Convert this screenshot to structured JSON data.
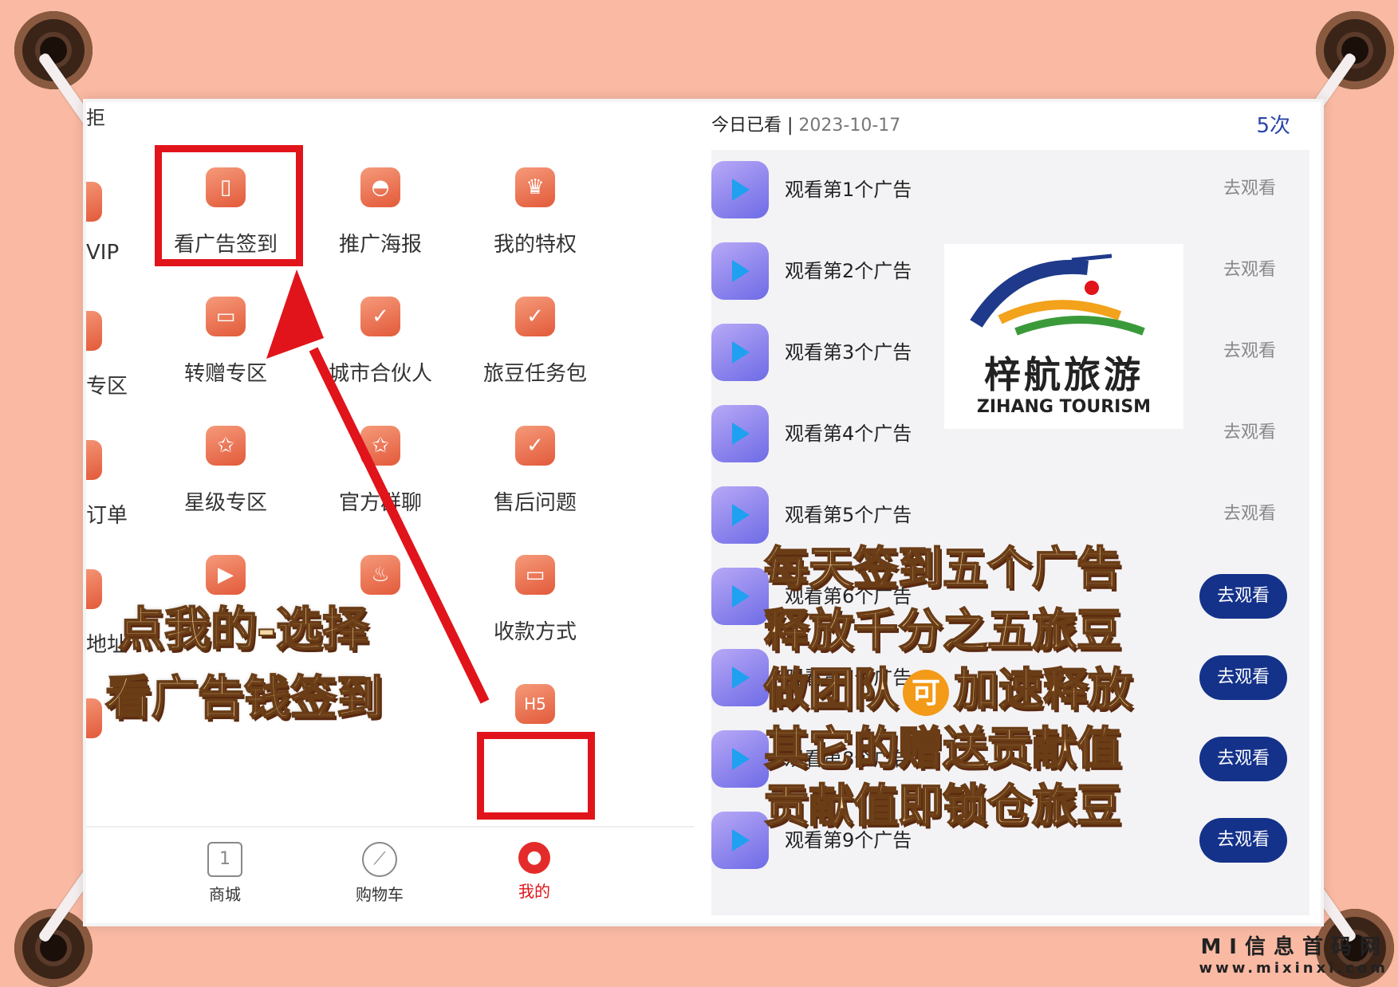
{
  "left_top_char": "拒",
  "grid": [
    {
      "label": "看广告签到",
      "icon": "phone-icon",
      "sym": "▯"
    },
    {
      "label": "推广海报",
      "icon": "poster-icon",
      "sym": "◓"
    },
    {
      "label": "我的特权",
      "icon": "crown-icon",
      "sym": "♛"
    },
    {
      "label": "转赠专区",
      "icon": "card-icon",
      "sym": "▭"
    },
    {
      "label": "城市合伙人",
      "icon": "shield-icon",
      "sym": "✓"
    },
    {
      "label": "旅豆任务包",
      "icon": "gift-icon",
      "sym": "✓"
    },
    {
      "label": "星级专区",
      "icon": "star-icon",
      "sym": "✩"
    },
    {
      "label": "官方群聊",
      "icon": "chat-icon",
      "sym": "✩"
    },
    {
      "label": "售后问题",
      "icon": "badge-icon",
      "sym": "✓"
    },
    {
      "label": "",
      "icon": "play-icon",
      "sym": "▶"
    },
    {
      "label": "",
      "icon": "fire-icon",
      "sym": "♨"
    },
    {
      "label": "收款方式",
      "icon": "wallet-icon",
      "sym": "▭"
    },
    {
      "label": "",
      "icon": "h5-icon",
      "sym": "H5"
    }
  ],
  "cut_labels": [
    "VIP",
    "专区",
    "订单",
    "地址"
  ],
  "nav": [
    {
      "label": "商城",
      "icon": "calendar-icon",
      "sym": "1"
    },
    {
      "label": "购物车",
      "icon": "compass-icon",
      "sym": "⟋"
    },
    {
      "label": "我的",
      "icon": "profile-icon",
      "sym": "●"
    }
  ],
  "left_overlay": [
    "点我的-选择",
    "看广告钱签到"
  ],
  "header": {
    "today_label": "今日已看 |",
    "date": "2023-10-17",
    "count": "5次"
  },
  "ads": [
    {
      "title": "观看第1个广告",
      "btn": "去观看",
      "active": false
    },
    {
      "title": "观看第2个广告",
      "btn": "去观看",
      "active": false
    },
    {
      "title": "观看第3个广告",
      "btn": "去观看",
      "active": false
    },
    {
      "title": "观看第4个广告",
      "btn": "去观看",
      "active": false
    },
    {
      "title": "观看第5个广告",
      "btn": "去观看",
      "active": false
    },
    {
      "title": "观看第6个广告",
      "btn": "去观看",
      "active": true
    },
    {
      "title": "观看第7个广告",
      "btn": "去观看",
      "active": true
    },
    {
      "title": "观看第8个广告",
      "btn": "去观看",
      "active": true
    },
    {
      "title": "观看第9个广告",
      "btn": "去观看",
      "active": true
    }
  ],
  "logo": {
    "cn": "梓航旅游",
    "en": "ZIHANG TOURISM"
  },
  "right_overlay": {
    "line1": "每天签到五个广告",
    "line2": "释放千分之五旅豆",
    "line3a": "做团队",
    "coin": "可",
    "line3b": "加速释放",
    "line4": "其它的赠送贡献值",
    "line5": "贡献值即锁仓旅豆"
  },
  "watermark": {
    "line1": "MI信息首码网",
    "line2": "www.mixinxi.com"
  },
  "colors": {
    "background": "#f9b9a3",
    "accent_red": "#e0141a",
    "blue_button": "#14328a",
    "count_blue": "#2a45a8"
  }
}
